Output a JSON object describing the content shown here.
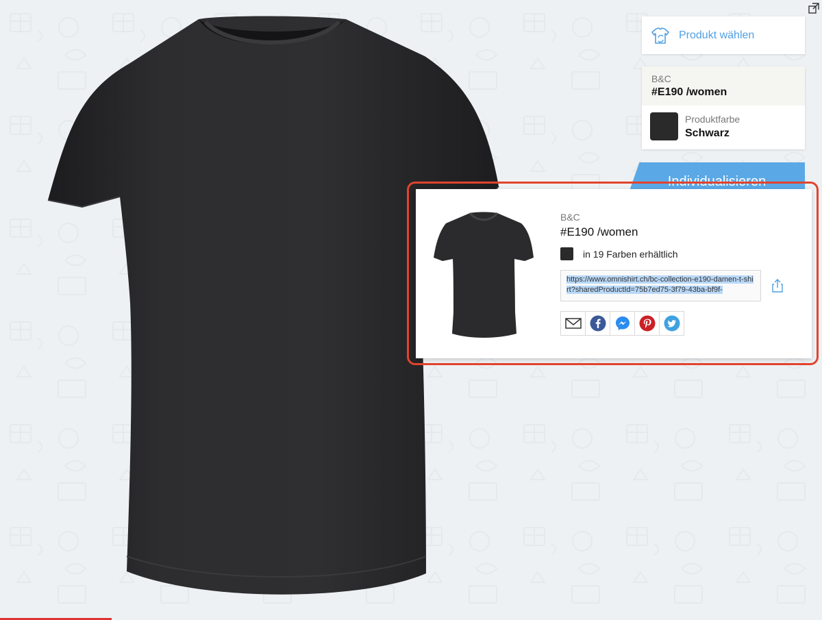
{
  "toolbar": {
    "expand_icon": "expand-window-icon"
  },
  "sidebar": {
    "choose_product": {
      "label": "Produkt wählen",
      "icon": "tshirt-swap-icon"
    },
    "product": {
      "brand": "B&C",
      "name": "#E190 /women",
      "color_label": "Produktfarbe",
      "color_value": "Schwarz",
      "color_hex": "#2a2a2a"
    },
    "customize_label": "Individualisieren"
  },
  "share_popup": {
    "brand": "B&C",
    "name": "#E190 /women",
    "colors_available": "in 19 Farben erhältlich",
    "url": "https://www.omnishirt.ch/bc-collection-e190-damen-t-shirt?sharedProductId=75b7ed75-3f79-43ba-bf9f-",
    "social": [
      {
        "name": "email-icon",
        "color": "#333333"
      },
      {
        "name": "facebook-icon",
        "color": "#3b5998"
      },
      {
        "name": "messenger-icon",
        "color": "#2a8cf0"
      },
      {
        "name": "pinterest-icon",
        "color": "#cb2027"
      },
      {
        "name": "twitter-icon",
        "color": "#3fa2e0"
      }
    ]
  },
  "colors": {
    "accent": "#4f9fe3",
    "button": "#5aa8e6",
    "highlight": "#e2432d",
    "shirt": "#2b2b2d"
  }
}
